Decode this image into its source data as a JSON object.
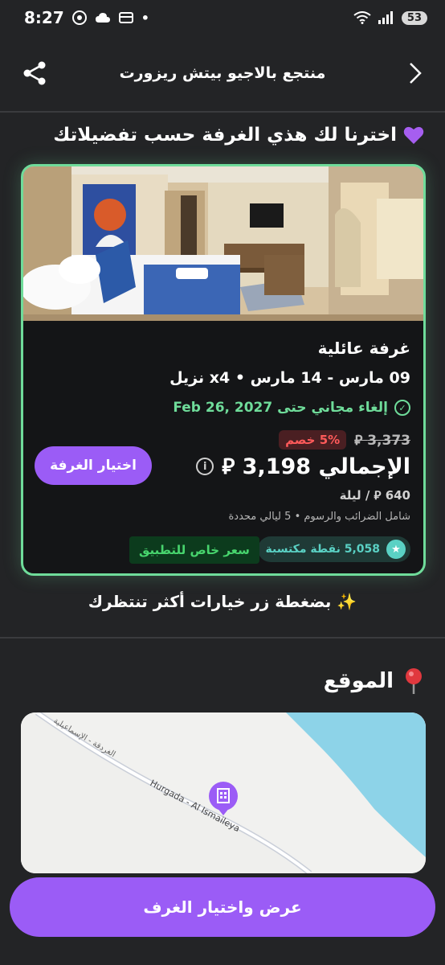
{
  "status_bar": {
    "time": "8:27",
    "battery": "53",
    "icons": [
      "chrome-icon",
      "cloud-icon",
      "wallet-icon",
      "dot-icon",
      "wifi-icon",
      "signal-icon"
    ]
  },
  "header": {
    "title": "منتجع بالاجيو بيتش ريزورت"
  },
  "recommendation": {
    "heading": "اخترنا لك هذي الغرفة حسب تفضيلاتك"
  },
  "room": {
    "name": "غرفة عائلية",
    "dates": "09 مارس - 14 مارس • x4 نزيل",
    "cancellation": "إلغاء مجاني حتى Feb 26, 2027",
    "old_price": "3,373 ⃁",
    "discount": "5% خصم",
    "total": "الإجمالي 3,198 ⃁",
    "per_night": "640 ⃁ / ليلة",
    "taxes_note": "شامل الضرائب والرسوم • 5 ليالي محددة",
    "points": "5,058 نقطة مكتسبة",
    "app_price": "سعر خاص للتطبيق",
    "choose_button": "اختيار الغرفة"
  },
  "more_options": "✨ بضغطة زر خيارات أكثر تنتظرك",
  "location": {
    "heading": "الموقع",
    "road_label": "Hurgada - Al Ismaileya",
    "road_label_ar": "الغردقة - الإسماعيلية"
  },
  "cta": {
    "label": "عرض واختيار الغرف"
  },
  "colors": {
    "background": "#232426",
    "accent": "#9b5cf6",
    "green": "#6fdc9a",
    "discount": "#ff5a5a"
  }
}
